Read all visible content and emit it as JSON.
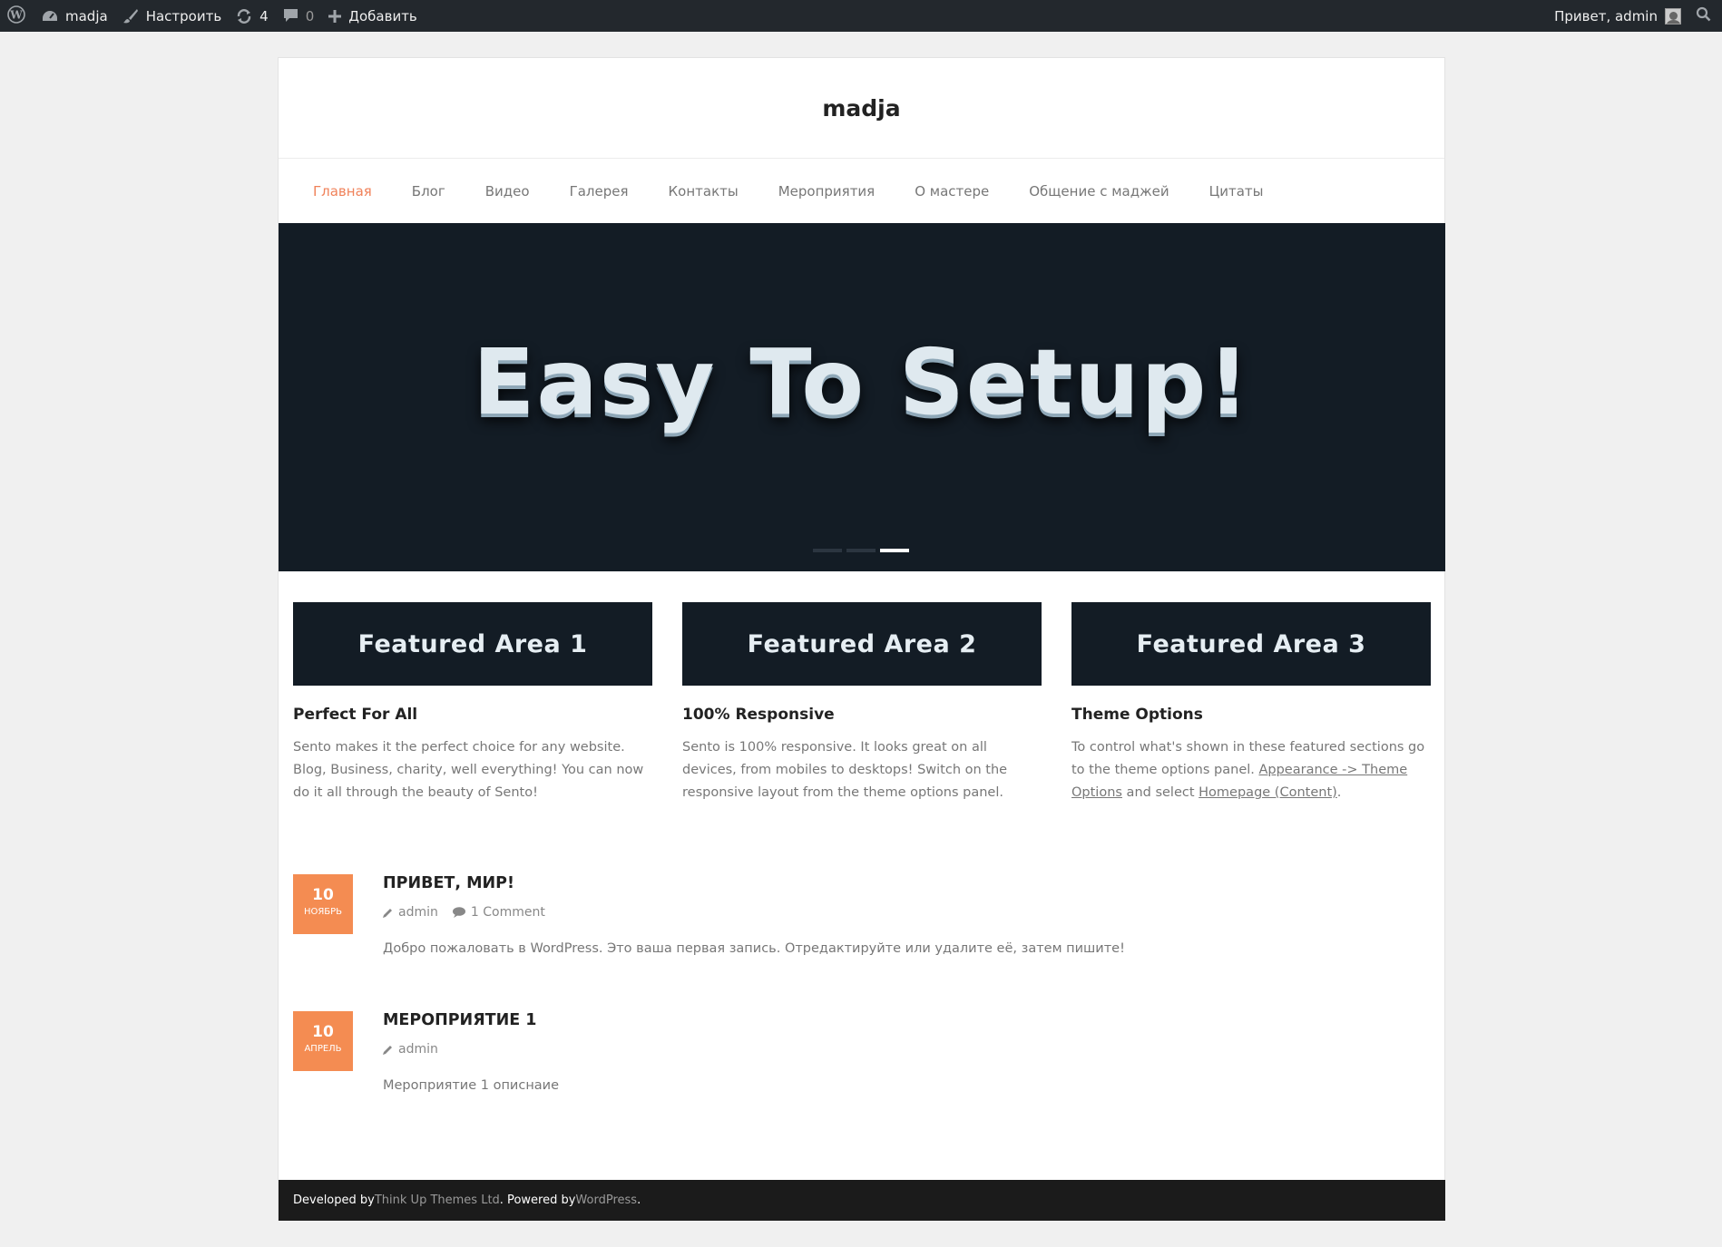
{
  "adminbar": {
    "site_name": "madja",
    "customize": "Настроить",
    "updates_count": "4",
    "comments_count": "0",
    "add_new": "Добавить",
    "greeting": "Привет, admin",
    "icons": [
      "wordpress-icon",
      "dashboard-icon",
      "brush-icon",
      "refresh-icon",
      "comment-icon",
      "plus-icon",
      "search-icon"
    ]
  },
  "site": {
    "title": "madja"
  },
  "nav": {
    "items": [
      {
        "label": "Главная"
      },
      {
        "label": "Блог"
      },
      {
        "label": "Видео"
      },
      {
        "label": "Галерея"
      },
      {
        "label": "Контакты"
      },
      {
        "label": "Мероприятия"
      },
      {
        "label": "О мастере"
      },
      {
        "label": "Общение с маджей"
      },
      {
        "label": "Цитаты"
      }
    ],
    "active_index": 0
  },
  "slider": {
    "headline": "Easy To Setup!",
    "slide_count": 3,
    "active_index": 2
  },
  "featured": [
    {
      "banner": "Featured Area 1",
      "title": "Perfect For All",
      "text": "Sento makes it the perfect choice for any website. Blog, Business, charity, well everything! You can now do it all through the beauty of Sento!"
    },
    {
      "banner": "Featured Area 2",
      "title": "100% Responsive",
      "text": "Sento is 100% responsive. It looks great on all devices, from mobiles to desktops! Switch on the responsive layout from the theme options panel."
    },
    {
      "banner": "Featured Area 3",
      "title": "Theme Options",
      "text_before": "To control what's shown in these featured sections go to the theme options panel. ",
      "link1": "Appearance -> Theme Options",
      "text_mid": " and select ",
      "link2": "Homepage (Content)",
      "text_after": "."
    }
  ],
  "posts": [
    {
      "day": "10",
      "month": "Ноябрь",
      "title": "Привет, мир!",
      "author": "admin",
      "comments": "1 Comment",
      "excerpt": "Добро пожаловать в WordPress. Это ваша первая запись. Отредактируйте или удалите её, затем пишите!"
    },
    {
      "day": "10",
      "month": "Апрель",
      "title": "Мероприятие 1",
      "author": "admin",
      "excerpt": "Мероприятие 1 описнаие"
    }
  ],
  "footer": {
    "developed_by": "Developed by ",
    "developer": "Think Up Themes Ltd",
    "powered_by": ". Powered by ",
    "platform": "WordPress",
    "end": "."
  },
  "colors": {
    "adminbar_bg": "#23282d",
    "accent": "#f0825a",
    "date_box": "#f48c52",
    "dark_banner": "#131c25",
    "footer_bg": "#1b1b1b"
  }
}
